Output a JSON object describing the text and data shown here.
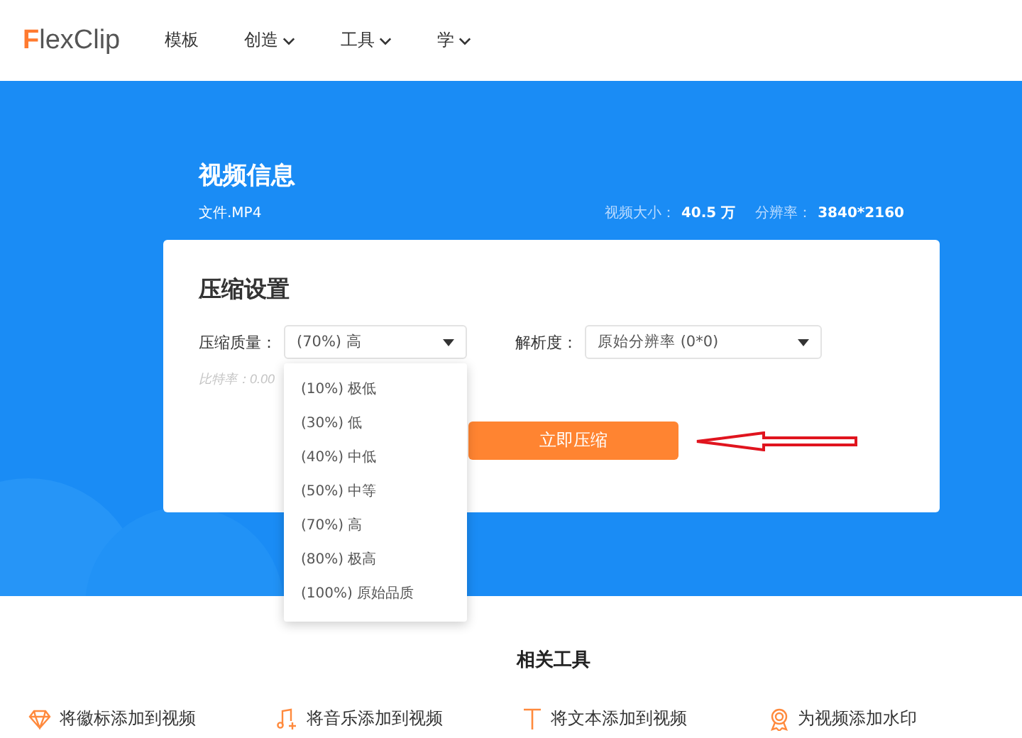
{
  "header": {
    "logo": "FlexClip",
    "nav": [
      {
        "label": "模板",
        "dropdown": false
      },
      {
        "label": "创造",
        "dropdown": true
      },
      {
        "label": "工具",
        "dropdown": true
      },
      {
        "label": "学",
        "dropdown": true
      }
    ]
  },
  "video_info": {
    "title": "视频信息",
    "file": "文件.MP4",
    "size_label": "视频大小：",
    "size": "40.5 万",
    "resolution_label": "分辨率：",
    "resolution": "3840*2160"
  },
  "compress_settings": {
    "title": "压缩设置",
    "quality": {
      "label": "压缩质量：",
      "value": "(70%) 高",
      "expanded": true,
      "options": [
        "(10%) 极低",
        "(30%) 低",
        "(40%) 中低",
        "(50%) 中等",
        "(70%) 高",
        "(80%) 极高",
        "(100%) 原始品质"
      ]
    },
    "resolution": {
      "label": "解析度：",
      "value": "原始分辨率 (0*0)"
    },
    "bitrate": "比特率：0.00",
    "button": "立即压缩"
  },
  "related_tools": {
    "title": "相关工具",
    "items": [
      {
        "label": "将徽标添加到视频",
        "kind": "diamond"
      },
      {
        "label": "将音乐添加到视频",
        "kind": "music"
      },
      {
        "label": "将文本添加到视频",
        "kind": "text"
      },
      {
        "label": "为视频添加水印",
        "kind": "badge"
      }
    ]
  }
}
